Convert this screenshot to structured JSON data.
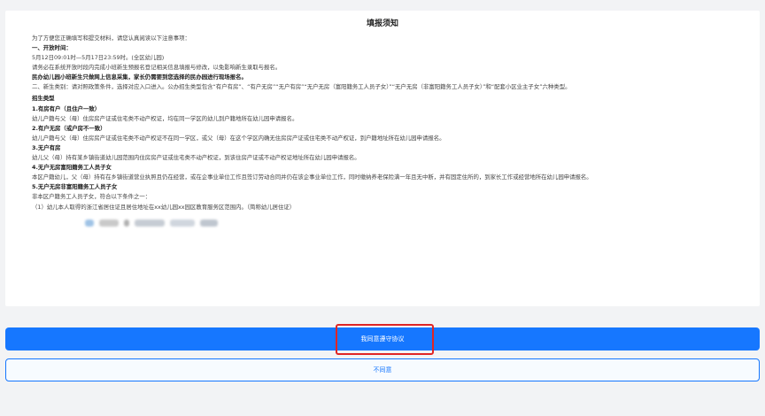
{
  "notice": {
    "title": "填报须知",
    "lines": [
      "为了方便您正确填写和提交材料，请您认真阅读以下注意事项：",
      "一、开放时间：",
      "5月12日09:01时—5月17日23:59时。(全区幼儿园)",
      "请务必在系统开放时段内完成小班新生预报名登记相关信息填报与修改，以免影响新生录取与报名。",
      "民办幼儿园小班新生只做网上信息采集，家长仍需要到您选择的民办园进行现场报名。",
      "二、新生类别：请对照政策条件，选择对应入口进入。公办招生类型包含“有户有房”、“有户无房”“无户有房”“无户无房（富阳籍务工人员子女）”“无户无房（非富阳籍务工人员子女）”和“配套小区业主子女”六种类型。",
      "招生类型",
      "1.有房有户（且住户一致）",
      "幼儿户籍与父（母）住房房产证或住宅类不动产权证，均在同一学区的幼儿到户籍地所在幼儿园申请报名。",
      "2.有户无房（或户房不一致）",
      "幼儿户籍与父（母）住房房产证或住宅类不动产权证不在同一学区，或父（母）在这个学区内确无住房房产证或住宅类不动产权证，到户籍地址所在幼儿园申请报名。",
      "3.无户有房",
      "幼儿父（母）持有某乡镇街道幼儿园范围内住房房产证或住宅类不动产权证，到该住房产证或不动产权证地址所在幼儿园申请报名。",
      "4.无户无房富阳籍务工人员子女",
      "本区户籍幼儿，父（母）持有在乡镇街道营业执照且仍在经营，或在企事业单位工作且签订劳动合同并仍在该企事业单位工作，同时缴纳养老保险满一年且无中断，并有固定住所的，到家长工作或经营地所在幼儿园申请报名。",
      "5.无户无房非富阳籍务工人员子女",
      "非本区户籍务工人员子女，符合以下条件之一：",
      "（1）幼儿本人取得的浙江省居住证且居住地址在xx幼儿园xx园区教育服务区范围内。（简称幼儿居住证）"
    ]
  },
  "buttons": {
    "agree": "我同意遵守协议",
    "disagree": "不同意"
  },
  "colors": {
    "primary": "#1677ff",
    "highlight": "#e02525"
  }
}
